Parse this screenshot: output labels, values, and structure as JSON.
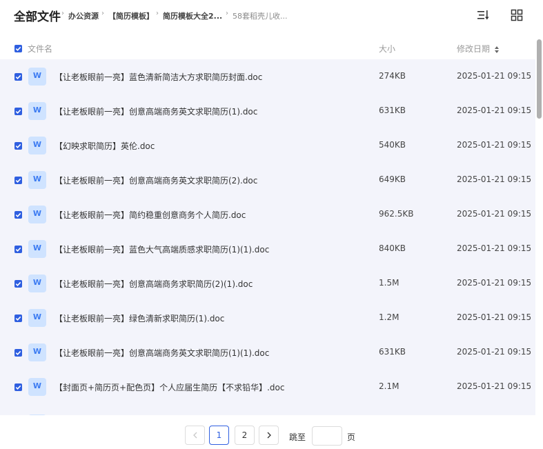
{
  "header": {
    "title": "全部文件",
    "breadcrumb": [
      "办公资源",
      "【简历模板】",
      "简历模板大全2...",
      "58套稻壳儿收..."
    ],
    "sort_icon": "sort-lines-icon",
    "view_icon": "grid-view-icon"
  },
  "columns": {
    "name": "文件名",
    "size": "大小",
    "modified": "修改日期"
  },
  "files": [
    {
      "name": "【让老板眼前一亮】蓝色清新简洁大方求职简历封面.doc",
      "size": "274KB",
      "modified": "2025-01-21 09:15"
    },
    {
      "name": "【让老板眼前一亮】创意高端商务英文求职简历(1).doc",
      "size": "631KB",
      "modified": "2025-01-21 09:15"
    },
    {
      "name": "【幻映求职简历】英伦.doc",
      "size": "540KB",
      "modified": "2025-01-21 09:15"
    },
    {
      "name": "【让老板眼前一亮】创意高端商务英文求职简历(2).doc",
      "size": "649KB",
      "modified": "2025-01-21 09:15"
    },
    {
      "name": "【让老板眼前一亮】简约稳重创意商务个人简历.doc",
      "size": "962.5KB",
      "modified": "2025-01-21 09:15"
    },
    {
      "name": "【让老板眼前一亮】蓝色大气高端质感求职简历(1)(1).doc",
      "size": "840KB",
      "modified": "2025-01-21 09:15"
    },
    {
      "name": "【让老板眼前一亮】创意高端商务求职简历(2)(1).doc",
      "size": "1.5M",
      "modified": "2025-01-21 09:15"
    },
    {
      "name": "【让老板眼前一亮】绿色清新求职简历(1).doc",
      "size": "1.2M",
      "modified": "2025-01-21 09:15"
    },
    {
      "name": "【让老板眼前一亮】创意高端商务英文求职简历(1)(1).doc",
      "size": "631KB",
      "modified": "2025-01-21 09:15"
    },
    {
      "name": "【封面页+简历页+配色页】个人应届生简历【不求铅华】.doc",
      "size": "2.1M",
      "modified": "2025-01-21 09:15"
    }
  ],
  "file_icon_letter": "W",
  "pagination": {
    "pages": [
      "1",
      "2"
    ],
    "current": "1",
    "jump_label": "跳至",
    "page_suffix": "页",
    "jump_value": ""
  },
  "colors": {
    "accent": "#2f5fe0",
    "list_bg": "#f3f4fb",
    "doc_icon_bg": "#cfe3ff",
    "doc_icon_fg": "#3d7cf2"
  }
}
